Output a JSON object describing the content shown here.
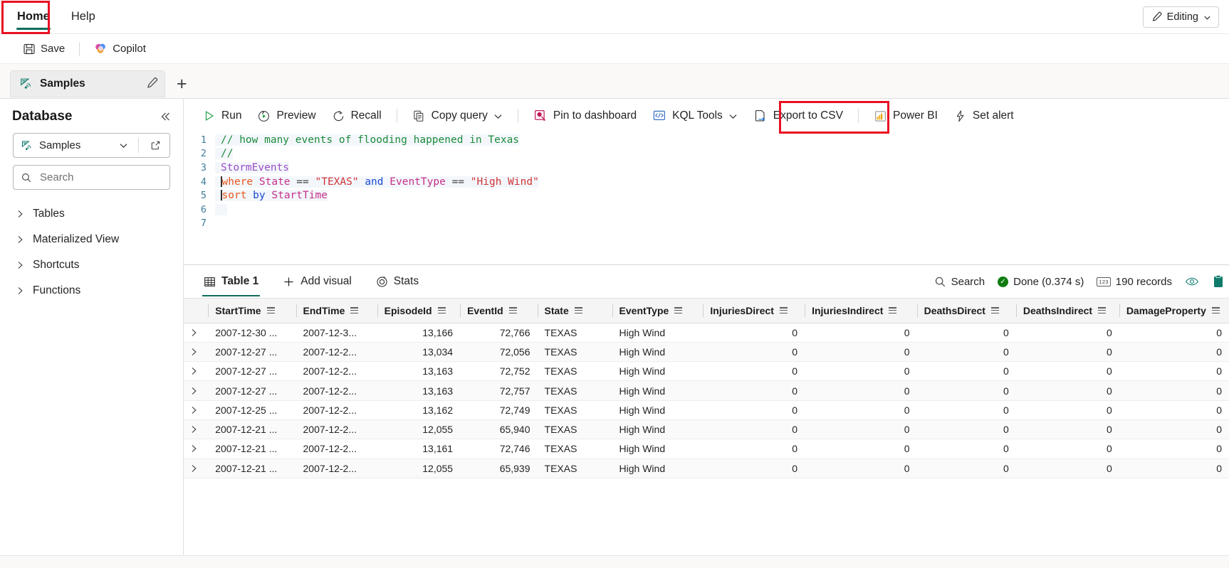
{
  "ribbon": {
    "tabs": [
      {
        "label": "Home",
        "active": true
      },
      {
        "label": "Help",
        "active": false
      }
    ],
    "editing_label": "Editing"
  },
  "commandbar": {
    "save_label": "Save",
    "copilot_label": "Copilot"
  },
  "document_tab": {
    "name": "Samples",
    "add_tab_label": "+"
  },
  "sidebar": {
    "title": "Database",
    "selected_database": "Samples",
    "search_placeholder": "Search",
    "search_value": "",
    "items": [
      {
        "label": "Tables"
      },
      {
        "label": "Materialized View"
      },
      {
        "label": "Shortcuts"
      },
      {
        "label": "Functions"
      }
    ]
  },
  "query_toolbar": {
    "items": [
      {
        "label": "Run",
        "icon": "play-icon"
      },
      {
        "label": "Preview",
        "icon": "preview-icon"
      },
      {
        "label": "Recall",
        "icon": "recall-icon"
      },
      {
        "label": "Copy query",
        "icon": "copy-icon",
        "caret": true
      },
      {
        "label": "Pin to dashboard",
        "icon": "pin-dashboard-icon"
      },
      {
        "label": "KQL Tools",
        "icon": "kql-tools-icon",
        "caret": true
      },
      {
        "label": "Export to CSV",
        "icon": "export-csv-icon",
        "highlighted": true
      },
      {
        "label": "Power BI",
        "icon": "power-bi-icon"
      },
      {
        "label": "Set alert",
        "icon": "set-alert-icon"
      }
    ]
  },
  "editor": {
    "lines": [
      {
        "num": "1",
        "text": "// how many events of flooding happened in Texas"
      },
      {
        "num": "2",
        "text": "//"
      },
      {
        "num": "3",
        "text": "StormEvents"
      },
      {
        "num": "4",
        "text": "| where State == \"TEXAS\" and EventType == \"High Wind\""
      },
      {
        "num": "5",
        "text": "| sort by StartTime"
      },
      {
        "num": "6",
        "text": ""
      },
      {
        "num": "7",
        "text": ""
      }
    ],
    "tokens": {
      "comment1": "// how many events of flooding happened in Texas",
      "comment2": "//",
      "table": "StormEvents",
      "pipe": "|",
      "where": "where",
      "state_col": "State",
      "eq": "==",
      "texas_str": "\"TEXAS\"",
      "and": "and",
      "eventtype_col": "EventType",
      "highwind_str": "\"High Wind\"",
      "sort": "sort",
      "by": "by",
      "starttime_col": "StartTime"
    }
  },
  "results": {
    "tabs": [
      {
        "label": "Table 1",
        "icon": "table-icon",
        "active": true
      },
      {
        "label": "Add visual",
        "icon": "plus-icon",
        "active": false
      },
      {
        "label": "Stats",
        "icon": "stats-icon",
        "active": false
      }
    ],
    "search_label": "Search",
    "status_label": "Done (0.374 s)",
    "records_label": "190 records",
    "columns": [
      "StartTime",
      "EndTime",
      "EpisodeId",
      "EventId",
      "State",
      "EventType",
      "InjuriesDirect",
      "InjuriesIndirect",
      "DeathsDirect",
      "DeathsIndirect",
      "DamageProperty"
    ],
    "rows": [
      [
        "2007-12-30 ...",
        "2007-12-3...",
        "13,166",
        "72,766",
        "TEXAS",
        "High Wind",
        "0",
        "0",
        "0",
        "0",
        "0"
      ],
      [
        "2007-12-27 ...",
        "2007-12-2...",
        "13,034",
        "72,056",
        "TEXAS",
        "High Wind",
        "0",
        "0",
        "0",
        "0",
        "0"
      ],
      [
        "2007-12-27 ...",
        "2007-12-2...",
        "13,163",
        "72,752",
        "TEXAS",
        "High Wind",
        "0",
        "0",
        "0",
        "0",
        "0"
      ],
      [
        "2007-12-27 ...",
        "2007-12-2...",
        "13,163",
        "72,757",
        "TEXAS",
        "High Wind",
        "0",
        "0",
        "0",
        "0",
        "0"
      ],
      [
        "2007-12-25 ...",
        "2007-12-2...",
        "13,162",
        "72,749",
        "TEXAS",
        "High Wind",
        "0",
        "0",
        "0",
        "0",
        "0"
      ],
      [
        "2007-12-21 ...",
        "2007-12-2...",
        "12,055",
        "65,940",
        "TEXAS",
        "High Wind",
        "0",
        "0",
        "0",
        "0",
        "0"
      ],
      [
        "2007-12-21 ...",
        "2007-12-2...",
        "13,161",
        "72,746",
        "TEXAS",
        "High Wind",
        "0",
        "0",
        "0",
        "0",
        "0"
      ],
      [
        "2007-12-21 ...",
        "2007-12-2...",
        "12,055",
        "65,939",
        "TEXAS",
        "High Wind",
        "0",
        "0",
        "0",
        "0",
        "0"
      ]
    ]
  },
  "colors": {
    "accent_teal": "#0f6c5c",
    "highlight_red": "#e81123",
    "status_green": "#107c10"
  }
}
